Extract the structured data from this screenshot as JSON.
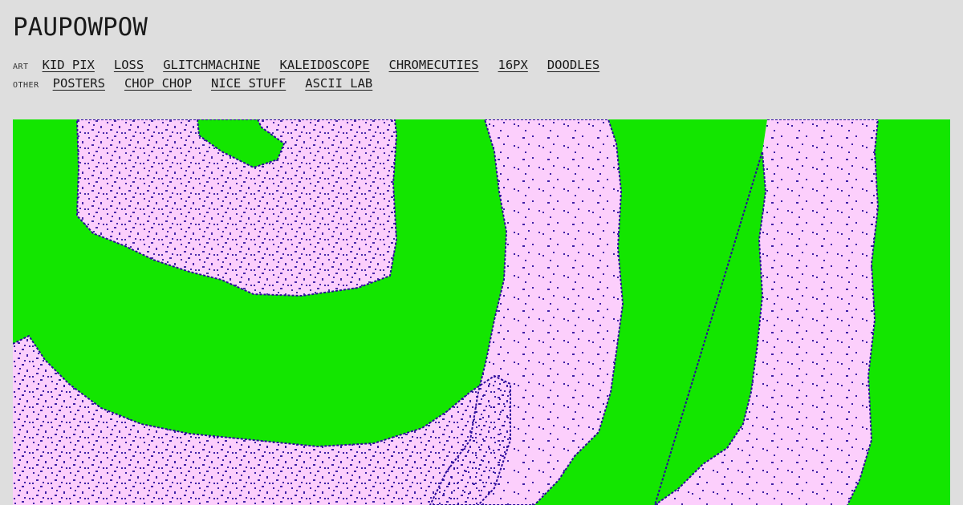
{
  "site": {
    "title": "PAUPOWPOW"
  },
  "nav": {
    "art": {
      "label": "ART",
      "links": [
        "KID PIX",
        "LOSS",
        "GLITCHMACHINE",
        "KALEIDOSCOPE",
        "CHROMECUTIES",
        "16PX",
        "DOODLES"
      ]
    },
    "other": {
      "label": "OTHER",
      "links": [
        "POSTERS",
        "CHOP CHOP",
        "NICE STUFF",
        "ASCII LAB"
      ]
    }
  },
  "artwork": {
    "colors": {
      "background": "#13e600",
      "fill": "#fccffc",
      "speckle": "#2a0a9c"
    }
  }
}
